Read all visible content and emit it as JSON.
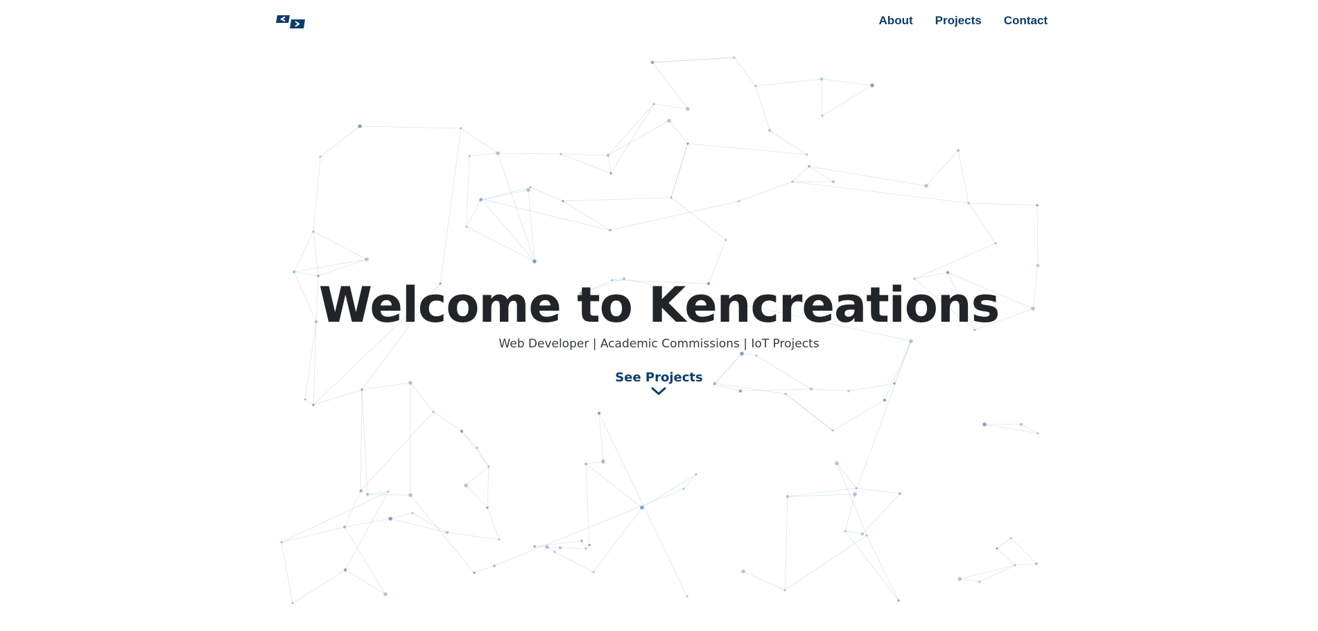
{
  "nav": {
    "logo_icon": "code-brackets-icon",
    "links": [
      "About",
      "Projects",
      "Contact"
    ]
  },
  "hero": {
    "title": "Welcome to Kencreations",
    "subtitle": "Web Developer | Academic Commissions | IoT Projects",
    "cta_label": "See Projects",
    "cta_icon": "chevron-down-icon"
  },
  "theme": {
    "primary": "#0d3d6b",
    "title_text": "#212529",
    "network": "#5b86b3",
    "background": "#ffffff"
  }
}
